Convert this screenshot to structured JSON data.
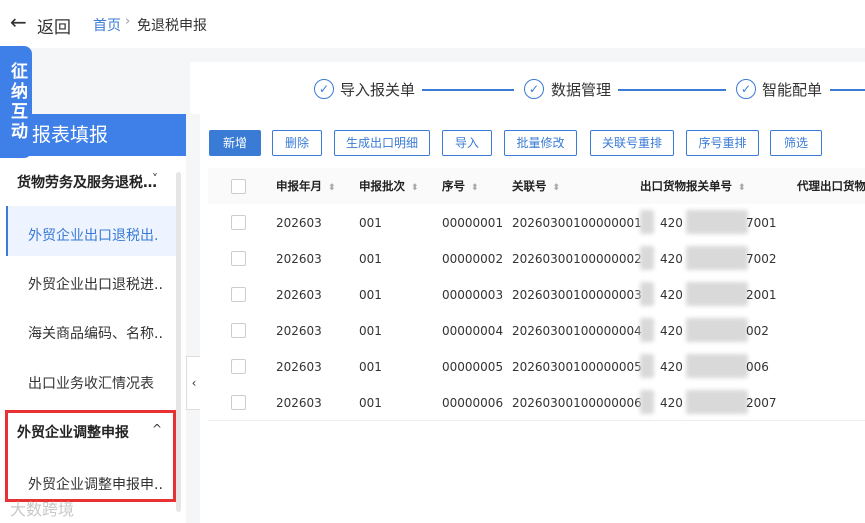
{
  "topbar": {
    "back_icon": "arrow-left-icon",
    "back_label": "返回",
    "breadcrumb": {
      "home": "首页",
      "separator": "›",
      "current": "免退税申报"
    }
  },
  "float_tab": {
    "label": "征纳互动"
  },
  "steps": [
    {
      "icon": "check-circle-icon",
      "label": "导入报关单"
    },
    {
      "icon": "check-circle-icon",
      "label": "数据管理"
    },
    {
      "icon": "check-circle-icon",
      "label": "智能配单"
    }
  ],
  "sidebar": {
    "title": "报表填报",
    "groups": [
      {
        "title": "货物劳务及服务退税…",
        "chevron": "˅",
        "items": [
          {
            "label": "外贸企业出口退税出.",
            "active": true
          },
          {
            "label": "外贸企业出口退税进.."
          },
          {
            "label": "海关商品编码、名称.."
          },
          {
            "label": "出口业务收汇情况表"
          }
        ]
      },
      {
        "title": "外贸企业调整申报",
        "chevron": "^",
        "items": [
          {
            "label": "外贸企业调整申报申.."
          }
        ]
      }
    ],
    "collapse_icon": "‹"
  },
  "toolbar": {
    "buttons": [
      {
        "label": "新增",
        "primary": true
      },
      {
        "label": "删除"
      },
      {
        "label": "生成出口明细"
      },
      {
        "label": "导入"
      },
      {
        "label": "批量修改"
      },
      {
        "label": "关联号重排"
      },
      {
        "label": "序号重排"
      },
      {
        "label": "筛选"
      }
    ]
  },
  "table": {
    "columns": [
      "申报年月",
      "申报批次",
      "序号",
      "关联号",
      "出口货物报关单号",
      "代理出口货物"
    ],
    "sort_icon": "⬍",
    "rows": [
      {
        "ym": "202603",
        "batch": "001",
        "seq": "00000001",
        "rel": "20260300100000001",
        "decl_prefix": "420",
        "decl_suffix": "7001"
      },
      {
        "ym": "202603",
        "batch": "001",
        "seq": "00000002",
        "rel": "20260300100000002",
        "decl_prefix": "420",
        "decl_suffix": "7002"
      },
      {
        "ym": "202603",
        "batch": "001",
        "seq": "00000003",
        "rel": "20260300100000003",
        "decl_prefix": "420",
        "decl_suffix": "2001"
      },
      {
        "ym": "202603",
        "batch": "001",
        "seq": "00000004",
        "rel": "20260300100000004",
        "decl_prefix": "420",
        "decl_suffix": "002"
      },
      {
        "ym": "202603",
        "batch": "001",
        "seq": "00000005",
        "rel": "20260300100000005",
        "decl_prefix": "420",
        "decl_suffix": "006"
      },
      {
        "ym": "202603",
        "batch": "001",
        "seq": "00000006",
        "rel": "20260300100000006",
        "decl_prefix": "420",
        "decl_suffix": "2007"
      }
    ]
  },
  "watermark": "大数跨境",
  "colors": {
    "accent": "#3a7bd5",
    "sidebar_header": "#3f7fe8",
    "highlight": "#e63232"
  }
}
